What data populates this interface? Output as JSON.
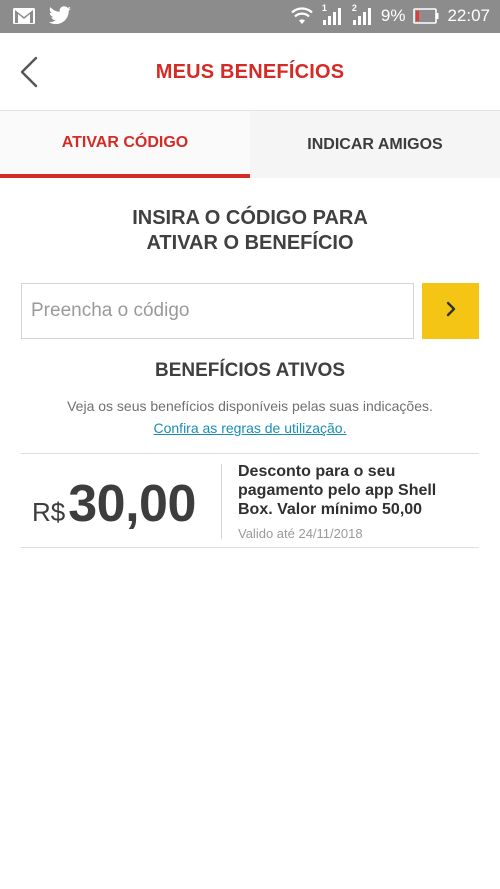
{
  "status_bar": {
    "battery": "9%",
    "time": "22:07",
    "sim1": "1",
    "sim2": "2"
  },
  "header": {
    "title": "MEUS BENEFÍCIOS"
  },
  "tabs": [
    {
      "label": "ATIVAR CÓDIGO",
      "active": true
    },
    {
      "label": "INDICAR AMIGOS",
      "active": false
    }
  ],
  "activate": {
    "title_line1": "INSIRA O CÓDIGO PARA",
    "title_line2": "ATIVAR O BENEFÍCIO",
    "input_placeholder": "Preencha o código",
    "input_value": ""
  },
  "benefits": {
    "title": "BENEFÍCIOS ATIVOS",
    "description": "Veja os seus benefícios disponíveis pelas suas indicações.",
    "rules_link": "Confira as regras de utilização.",
    "items": [
      {
        "currency": "R$",
        "value": "30,00",
        "description": "Desconto para o seu pagamento pelo app Shell Box. Valor mínimo 50,00",
        "valid_until": "Valido até 24/11/2018"
      }
    ]
  },
  "colors": {
    "accent_red": "#d42b26",
    "button_yellow": "#f5c515",
    "link_blue": "#1a8fb4",
    "status_bar": "#8c8c8c"
  },
  "icons": [
    "gmail-icon",
    "twitter-icon",
    "wifi-icon",
    "signal-icon",
    "battery-icon",
    "back-arrow-icon",
    "chevron-right-icon"
  ]
}
